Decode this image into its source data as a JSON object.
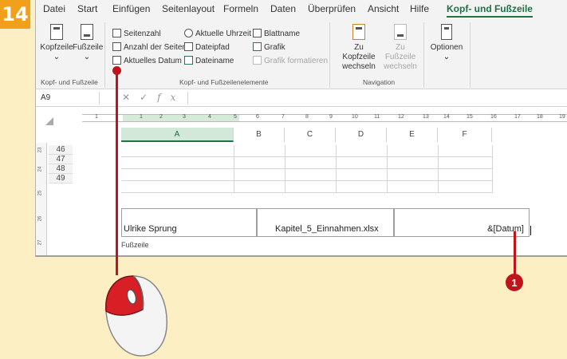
{
  "step_number": "14",
  "tabs": [
    "Datei",
    "Start",
    "Einfügen",
    "Seitenlayout",
    "Formeln",
    "Daten",
    "Überprüfen",
    "Ansicht",
    "Hilfe",
    "Kopf- und Fußzeile"
  ],
  "ribbon": {
    "group1": {
      "header_button": "Kopfzeile",
      "footer_button": "Fußzeile",
      "label": "Kopf- und Fußzeile"
    },
    "group2": {
      "items": [
        "Seitenzahl",
        "Aktuelle Uhrzeit",
        "Blattname",
        "Anzahl der Seiten",
        "Dateipfad",
        "Grafik",
        "Aktuelles Datum",
        "Dateiname",
        "Grafik formatieren"
      ],
      "label": "Kopf- und Fußzeilenelemente"
    },
    "group3": {
      "goto_header": "Zu Kopfzeile wechseln",
      "goto_footer": "Zu Fußzeile wechseln",
      "label": "Navigation"
    },
    "options": "Optionen"
  },
  "name_box": "A9",
  "fx_symbol": "fx",
  "ruler_numbers": [
    "1",
    "1",
    "2",
    "3",
    "4",
    "5",
    "6",
    "7",
    "8",
    "9",
    "10",
    "11",
    "12",
    "13",
    "14",
    "15",
    "16",
    "17",
    "18",
    "19"
  ],
  "columns": [
    "A",
    "B",
    "C",
    "D",
    "E",
    "F"
  ],
  "rows": [
    "46",
    "47",
    "48",
    "49"
  ],
  "vruler_numbers": [
    "23",
    "24",
    "25",
    "26",
    "27"
  ],
  "footer": {
    "left": "Ulrike Sprung",
    "center": "Kapitel_5_Einnahmen.xlsx",
    "right": "&[Datum]",
    "label": "Fußzeile"
  },
  "callout_number": "1",
  "colors": {
    "accent": "#217346",
    "marker": "#c0131c",
    "badge": "#f2a01c"
  }
}
